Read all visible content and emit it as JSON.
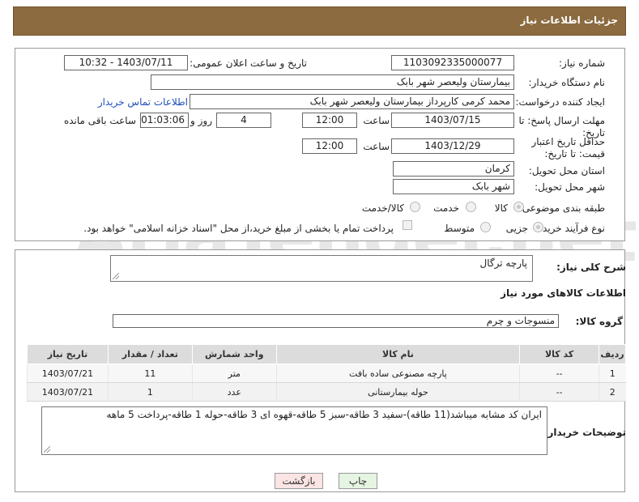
{
  "header": {
    "title": "جزئیات اطلاعات نیاز"
  },
  "form": {
    "need_number_label": "شماره نیاز:",
    "need_number": "1103092335000077",
    "announce_label": "تاریخ و ساعت اعلان عمومی:",
    "announce_value": "1403/07/11 - 10:32",
    "buyer_org_label": "نام دستگاه خریدار:",
    "buyer_org": "بیمارستان ولیعصر شهر بابک",
    "creator_label": "ایجاد کننده درخواست:",
    "creator": "محمد  کرمی  کارپرداز  بیمارستان ولیعصر شهر بابک",
    "contact_link": "اطلاعات تماس خریدار",
    "reply_deadline_label": "مهلت ارسال پاسخ: تا تاریخ:",
    "reply_date": "1403/07/15",
    "time_label": "ساعت",
    "reply_time": "12:00",
    "days_value": "4",
    "days_label": "روز و",
    "remaining_time": "01:03:06",
    "remaining_label": "ساعت باقی مانده",
    "price_validity_label": "حداقل تاریخ اعتبار قیمت: تا تاریخ:",
    "validity_date": "1403/12/29",
    "validity_time": "12:00",
    "province_label": "استان محل تحویل:",
    "province": "کرمان",
    "city_label": "شهر محل تحویل:",
    "city": "شهر بابک",
    "category_label": "طبقه بندی موضوعی:",
    "category_options": [
      "کالا",
      "خدمت",
      "کالا/خدمت"
    ],
    "process_label": "نوع فرآیند خرید :",
    "process_options": [
      "جزیی",
      "متوسط"
    ],
    "payment_note": "پرداخت تمام یا بخشی از مبلغ خرید،از محل \"اسناد خزانه اسلامی\" خواهد بود."
  },
  "details": {
    "description_label": "شرح کلی نیاز:",
    "description": "پارچه ترگال",
    "goods_info_title": "اطلاعات کالاهای مورد نیاز",
    "goods_group_label": "گروه کالا:",
    "goods_group": "منسوجات و چرم"
  },
  "table": {
    "headers": [
      "ردیف",
      "کد کالا",
      "نام کالا",
      "واحد شمارش",
      "تعداد / مقدار",
      "تاریخ نیاز"
    ],
    "rows": [
      [
        "1",
        "--",
        "پارچه مصنوعی ساده بافت",
        "متر",
        "11",
        "1403/07/21"
      ],
      [
        "2",
        "--",
        "حوله بیمارستانی",
        "عدد",
        "1",
        "1403/07/21"
      ]
    ]
  },
  "buyer_notes": {
    "label": "توضیحات خریدار:",
    "text": "ایران کد مشابه میباشد(11 طاقه)-سفید 3 طاقه-سبز 5 طاقه-قهوه ای 3 طاقه-حوله 1 طاقه-پرداخت 5 ماهه"
  },
  "buttons": {
    "print": "چاپ",
    "back": "بازگشت"
  },
  "watermark": "AriaTender.net"
}
